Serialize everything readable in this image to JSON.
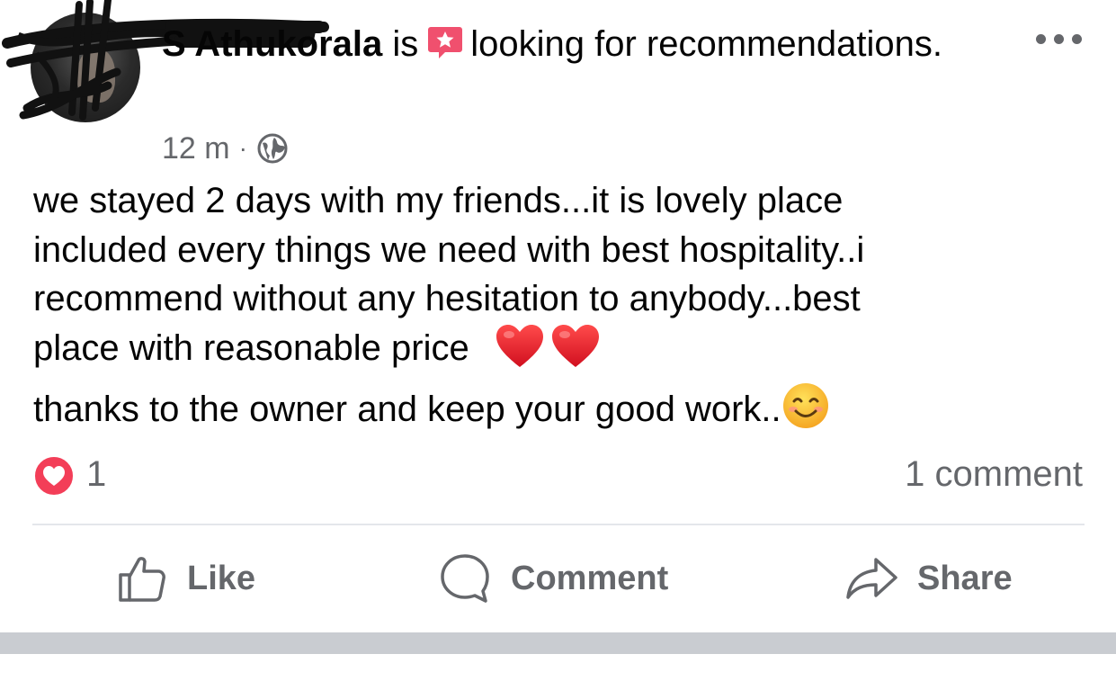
{
  "post": {
    "author": {
      "name": "S Athukorala",
      "status_verb": "is",
      "status_icon": "recommendation-star-icon",
      "status_text": "looking for recommendations."
    },
    "timestamp": "12 m",
    "separator_dot": "·",
    "audience_icon": "globe-icon",
    "body": {
      "line1": "we stayed 2 days with my friends...it is lovely place",
      "line2": "included every things we need with best hospitality..i",
      "line3": "recommend without any hesitation to anybody...best",
      "line4": "place with reasonable price",
      "line4_emojis": [
        "red-heart",
        "red-heart"
      ],
      "line5": "thanks to the owner and keep your good work..",
      "line5_emoji": "smiling-face"
    },
    "reactions": {
      "icon": "love-reaction-icon",
      "count": "1"
    },
    "comments_label": "1 comment",
    "actions": {
      "like": "Like",
      "comment": "Comment",
      "share": "Share"
    }
  },
  "colors": {
    "text": "#050505",
    "secondary_text": "#65676b",
    "love_red": "#f33e58",
    "badge_pink": "#f0506e",
    "divider": "#e4e6eb",
    "separator": "#c9ccd1"
  }
}
